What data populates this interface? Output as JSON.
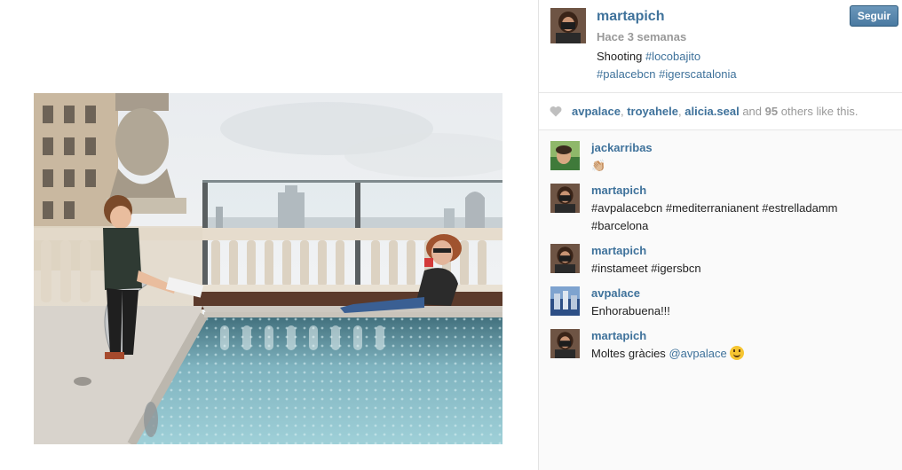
{
  "post": {
    "username": "martapich",
    "time_ago": "Hace 3 semanas",
    "follow_label": "Seguir",
    "caption": {
      "text": "Shooting",
      "tags": [
        "#locobajito",
        "#palacebcn",
        "#igerscatalonia"
      ]
    }
  },
  "likes": {
    "users": [
      "avpalace",
      "troyahele",
      "alicia.seal"
    ],
    "sep1": ",",
    "sep2": ",",
    "and_text": "and",
    "count": "95",
    "suffix": "others like this."
  },
  "comments": [
    {
      "user": "jackarribas",
      "text": "👏🏼"
    },
    {
      "user": "martapich",
      "text": "#avpalacebcn #mediterranianent #estrelladamm #barcelona"
    },
    {
      "user": "martapich",
      "text": "#instameet #igersbcn"
    },
    {
      "user": "avpalace",
      "text": "Enhorabuena!!!"
    },
    {
      "user": "martapich",
      "text": "Moltes gràcies",
      "mention": "@avpalace"
    }
  ],
  "colors": {
    "link": "#3f729b",
    "muted": "#999999",
    "follow_button": "#4a7aa1"
  },
  "icons": {
    "heart": "heart-icon",
    "smile": "smile-emoji-icon"
  }
}
